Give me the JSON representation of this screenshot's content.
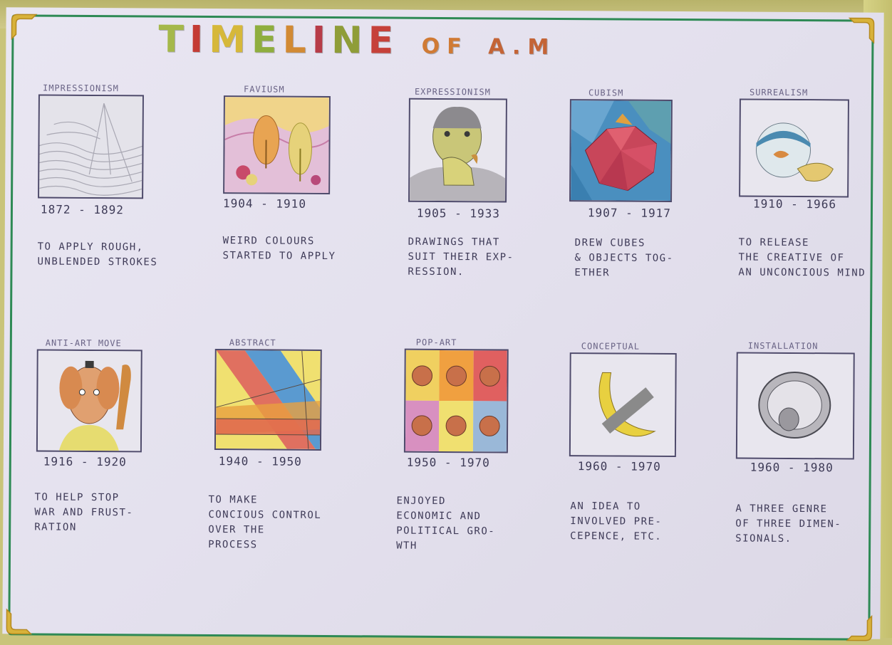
{
  "title": {
    "letters": [
      {
        "ch": "T",
        "color": "#a5b84a"
      },
      {
        "ch": "I",
        "color": "#c43b34"
      },
      {
        "ch": "M",
        "color": "#d6b83a"
      },
      {
        "ch": "E",
        "color": "#8fae3e"
      },
      {
        "ch": "L",
        "color": "#d28a34"
      },
      {
        "ch": "I",
        "color": "#b73c48"
      },
      {
        "ch": "N",
        "color": "#8f9d38"
      },
      {
        "ch": "E",
        "color": "#c6413a"
      }
    ],
    "of": "OF",
    "am": "A.M",
    "of_color": "#d07a34",
    "am_color": "#c46436",
    "full_text": "TIMELINE OF A.M"
  },
  "movements": [
    {
      "name": "IMPRESSIONISM",
      "years": "1872 - 1892",
      "desc": [
        "TO APPLY ROUGH,",
        "UNBLENDED STROKES"
      ]
    },
    {
      "name": "FAVIUSM",
      "years": "1904 - 1910",
      "desc": [
        "WEIRD COLOURS",
        "STARTED TO APPLY"
      ]
    },
    {
      "name": "EXPRESSIONISM",
      "years": "1905 - 1933",
      "desc": [
        "DRAWINGS THAT",
        "SUIT THEIR EXP-",
        "RESSION."
      ]
    },
    {
      "name": "CUBISM",
      "years": "1907 - 1917",
      "desc": [
        "DREW CUBES",
        "& OBJECTS TOG-",
        "ETHER"
      ]
    },
    {
      "name": "SURREALISM",
      "years": "1910 - 1966",
      "desc": [
        "TO RELEASE",
        "THE CREATIVE OF",
        "AN UNCONCIOUS MIND"
      ]
    },
    {
      "name": "ANTI-ART MOVE",
      "years": "1916 - 1920",
      "desc": [
        "TO HELP STOP",
        "WAR AND FRUST-",
        "RATION"
      ]
    },
    {
      "name": "ABSTRACT",
      "years": "1940 - 1950",
      "desc": [
        "TO MAKE",
        "CONCIOUS CONTROL",
        "OVER THE",
        "PROCESS"
      ]
    },
    {
      "name": "POP-ART",
      "years": "1950 - 1970",
      "desc": [
        "ENJOYED",
        "ECONOMIC AND",
        "POLITICAL GRO-",
        "WTH"
      ]
    },
    {
      "name": "CONCEPTUAL",
      "years": "1960 - 1970",
      "desc": [
        "AN IDEA TO",
        "INVOLVED PRE-",
        "CEPENCE, ETC."
      ]
    },
    {
      "name": "INSTALLATION",
      "years": "1960 - 1980",
      "desc": [
        "A THREE GENRE",
        "OF THREE DIMEN-",
        "SIONALS."
      ]
    }
  ],
  "colors": {
    "border_green": "#2e8a55",
    "ink": "#3f3b58",
    "paper": "#e6e3ef"
  }
}
